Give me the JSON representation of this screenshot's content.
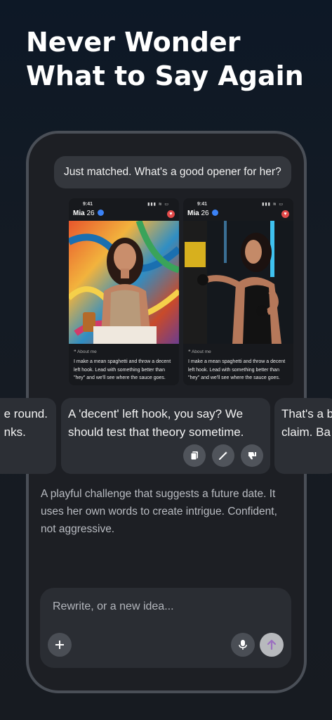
{
  "headline": {
    "line1": "Never Wonder",
    "line2": "What to Say Again"
  },
  "chat": {
    "user_message": "Just matched. What's a good opener for her?"
  },
  "profiles": [
    {
      "time": "9:41",
      "signal": "▮▮▮ ≋ ▭",
      "name": "Mia",
      "age": "26",
      "about_label": "❝ About me",
      "about": "I make a mean spaghetti and throw a decent left hook. Lead with something better than \"hey\" and we'll see where the sauce goes."
    },
    {
      "time": "9:41",
      "signal": "▮▮▮ ≋ ▭",
      "name": "Mia",
      "age": "26",
      "about_label": "❝ About me",
      "about": "I make a mean spaghetti and throw a decent left hook. Lead with something better than \"hey\" and we'll see where the sauce goes."
    }
  ],
  "suggestions": {
    "left": {
      "line1": "e round.",
      "line2": "nks."
    },
    "center": {
      "line1": "A 'decent' left hook, you say? We",
      "line2": "should test that theory sometime."
    },
    "right": {
      "line1": "That's a b",
      "line2": "claim. Ba"
    }
  },
  "explanation": "A playful challenge that suggests a future date. It uses her own words to create intrigue. Confident, not aggressive.",
  "composer": {
    "placeholder": "Rewrite, or a new idea..."
  },
  "icons": [
    "copy-icon",
    "magic-wand-icon",
    "thumbs-down-icon",
    "plus-icon",
    "microphone-icon",
    "send-arrow-icon"
  ],
  "colors": {
    "accent": "#9b6fc0",
    "verified": "#3b82f6",
    "heart": "#e34a4a"
  }
}
